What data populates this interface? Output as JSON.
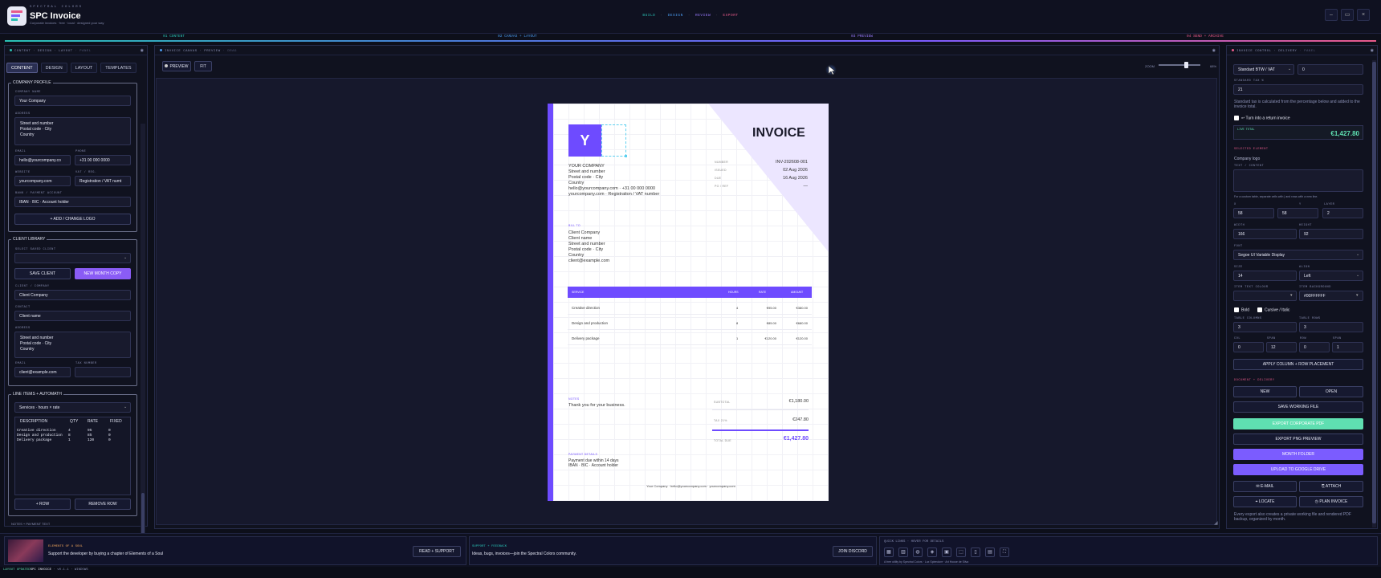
{
  "app": {
    "brand_sub": "SPECTRAL COLORS",
    "title": "SPC Invoice",
    "tagline": "Corporate invoices · free · local · designed your way",
    "nav": [
      "BUILD",
      "DESIGN",
      "REVIEW",
      "EXPORT"
    ],
    "nav_sep": "·",
    "window_buttons": [
      "–",
      "▭",
      "×"
    ]
  },
  "steps": [
    "01 CONTENT",
    "02 CANVAS + LAYOUT",
    "03 PREVIEW",
    "04 SEND + ARCHIVE"
  ],
  "left_panel": {
    "title": "CONTENT · DESIGN · LAYOUT",
    "title_dim": "· PANEL",
    "tabs": [
      "CONTENT",
      "DESIGN",
      "LAYOUT",
      "TEMPLATES"
    ],
    "company": {
      "section_title": "COMPANY PROFILE",
      "name_label": "COMPANY NAME",
      "name": "Your Company",
      "address_label": "ADDRESS",
      "address": [
        "Street and number",
        "Postal code · City",
        "Country"
      ],
      "email_label": "EMAIL",
      "email": "hello@yourcompany.co",
      "phone_label": "PHONE",
      "phone": "+31 00 000 0000",
      "website_label": "WEBSITE",
      "website": "yourcompany.com",
      "vat_label": "VAT / REG.",
      "vat": "Registration / VAT numt",
      "bank_label": "BANK / PAYMENT ACCOUNT",
      "bank": "IBAN · BIC · Account holder",
      "logo_button": "+ ADD / CHANGE LOGO"
    },
    "client": {
      "section_title": "CLIENT LIBRARY",
      "saved_label": "SELECT SAVED CLIENT",
      "saved_value": "",
      "save_button": "SAVE CLIENT",
      "new_month_button": "NEW MONTH COPY",
      "company_label": "CLIENT / COMPANY",
      "company": "Client Company",
      "contact_label": "CONTACT",
      "contact": "Client name",
      "address_label": "ADDRESS",
      "address": [
        "Street and number",
        "Postal code · City",
        "Country"
      ],
      "email_label": "EMAIL",
      "email": "client@example.com",
      "tax_label": "TAX NUMBER",
      "tax": ""
    },
    "line_items": {
      "section_title": "LINE ITEMS + AUTOMATH",
      "mode": "Services · hours × rate",
      "headers": [
        "DESCRIPTION",
        "QTY",
        "RATE",
        "FIXED"
      ],
      "rows": [
        [
          "Creative direction",
          "4",
          "95",
          "0"
        ],
        [
          "Design and production",
          "8",
          "85",
          "0"
        ],
        [
          "Delivery package",
          "1",
          "120",
          "0"
        ]
      ],
      "add_row": "+ ROW",
      "remove_row": "REMOVE ROW",
      "next_section": "NOTES + PAYMENT TEXT"
    }
  },
  "center_panel": {
    "title": "INVOICE CANVAS · PREVIEW",
    "title_dim": "· DRAG",
    "preview_button": "PREVIEW",
    "fit_button": "FIT",
    "zoom_label": "ZOOM",
    "zoom_value": "68%",
    "zoom_fraction": 0.68
  },
  "invoice": {
    "logo_letter": "Y",
    "title": "INVOICE",
    "meta_labels": [
      "NUMBER",
      "ISSUED",
      "DUE",
      "PO / REF"
    ],
    "meta_values": [
      "INV-202608-001",
      "02 Aug 2026",
      "16 Aug 2026",
      "—"
    ],
    "company_lines": [
      "YOUR COMPANY",
      "Street and number",
      "Postal code · City",
      "Country",
      "hello@yourcompany.com  ·  +31 00 000 0000",
      "yourcompany.com  ·  Registration / VAT number"
    ],
    "bill_to_label": "BILL TO",
    "bill_to_lines": [
      "Client Company",
      "Client name",
      "Street and number",
      "Postal code · City",
      "Country",
      "client@example.com"
    ],
    "table_headers": [
      "SERVICE",
      "HOURS",
      "RATE",
      "AMOUNT"
    ],
    "table_rows": [
      [
        "Creative direction",
        "4",
        "€95.00",
        "€380.00"
      ],
      [
        "Design and production",
        "8",
        "€85.00",
        "€680.00"
      ],
      [
        "Delivery package",
        "1",
        "€120.00",
        "€120.00"
      ]
    ],
    "notes_label": "NOTES",
    "notes_text": "Thank you for your business.",
    "subtotal_label": "SUBTOTAL",
    "subtotal": "€1,180.00",
    "tax_label": "TAX 21%",
    "tax": "€247.80",
    "total_label": "TOTAL DUE",
    "total": "€1,427.80",
    "payment_label": "PAYMENT DETAILS",
    "payment_lines": [
      "Payment due within 14 days",
      "IBAN · BIC · Account holder"
    ],
    "footer_line": "Your Company  ·  hello@yourcompany.com  ·  yourcompany.com"
  },
  "right_panel": {
    "title": "INVOICE CONTROL · DELIVERY",
    "title_dim": "· PANEL",
    "tax_mode": "Standard BTW / VAT",
    "tax_extra": "0",
    "std_tax_label": "STANDARD TAX %",
    "std_tax": "21",
    "tax_note": "Standard tax is calculated from the percentage below and added to the invoice total.",
    "return_label": "↩ Turn into a return invoice",
    "live_total_label": "LIVE TOTAL",
    "live_total": "€1,427.80",
    "selected_label": "SELECTED ELEMENT",
    "selected_name": "Company logo",
    "text_label": "TEXT / CONTENT",
    "text_value": "",
    "table_hint": "For a custom table, separate cells with | and rows with a new line.",
    "x_label": "X",
    "x": "58",
    "y_label": "Y",
    "y": "58",
    "layer_label": "LAYER",
    "layer": "2",
    "width_label": "WIDTH",
    "width": "166",
    "height_label": "HEIGHT",
    "height": "92",
    "font_label": "FONT",
    "font": "Segoe UI Variable Display",
    "size_label": "SIZE",
    "size": "14",
    "align_label": "ALIGN",
    "align": "Left",
    "item_text_label": "ITEM TEXT COLOUR",
    "item_text": "",
    "item_bg_label": "ITEM BACKGROUND",
    "item_bg": "#00FFFFFF",
    "bold_label": "Bold",
    "italic_label": "Cursive / Italic",
    "table_cols_label": "TABLE COLUMNS",
    "table_cols": "3",
    "table_rows_label": "TABLE ROWS",
    "table_rows": "3",
    "col_label": "COL",
    "col": "0",
    "span1_label": "SPAN",
    "span1": "12",
    "row_label": "ROW",
    "row": "0",
    "span2_label": "SPAN",
    "span2": "1",
    "apply_button": "APPLY COLUMN + ROW PLACEMENT",
    "doc_label": "DOCUMENT + DELIVERY",
    "new_button": "NEW",
    "open_button": "OPEN",
    "save_button": "SAVE WORKING FILE",
    "export_pdf": "EXPORT CORPORATE PDF",
    "export_png": "EXPORT PNG PREVIEW",
    "month_folder": "MONTH FOLDER",
    "upload_drive": "UPLOAD TO GOOGLE DRIVE",
    "email_button": "✉ E-MAIL",
    "attach_button": "⎘ ATTACH",
    "locate_button": "⌖ LOCATE",
    "plan_button": "◷ PLAN INVOICE",
    "export_note": "Every export also creates a private working file and rendered PDF backup, organized by month."
  },
  "footer": {
    "promo_label": "ELEMENTS OF A SOUL",
    "promo_text": "Support the developer by buying a chapter of Elements of a Soul",
    "read_button": "READ + SUPPORT",
    "support_label": "SUPPORT + FEEDBACK",
    "support_text": "Ideas, bugs, invoices—join the Spectral Colors community.",
    "discord_button": "JOIN DISCORD",
    "quick_label": "QUICK LINKS  ·  HOVER FOR DETAILS",
    "quick_caption": "A free utility by Spectral Colors  ·  Lux Splendore  ·  Art House de Silva",
    "quick_icons": [
      "▦",
      "▥",
      "◍",
      "◈",
      "▣",
      "⬚",
      "▯",
      "▤",
      "⛶"
    ]
  },
  "status": {
    "left": "LAYOUT UPDATED",
    "app": "SPC INVOICE",
    "version": "v0.1.1",
    "platform": "WINDOWS"
  },
  "colors": {
    "accent": "#7b5cff",
    "teal": "#29c0b4",
    "pink": "#e85a8a",
    "green": "#5fdfb1"
  }
}
